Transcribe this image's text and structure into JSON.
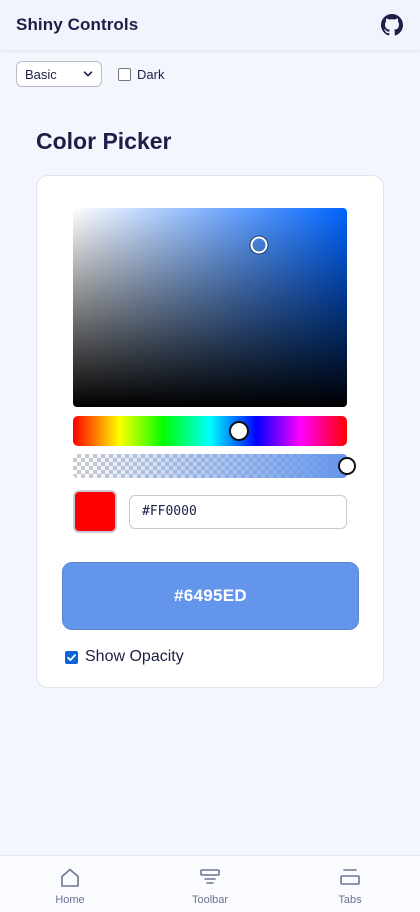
{
  "header": {
    "title": "Shiny Controls",
    "github_icon": "github-icon"
  },
  "controls": {
    "mode_select": {
      "value": "Basic",
      "icon": "chevron-down-icon"
    },
    "dark_toggle": {
      "label": "Dark",
      "checked": false
    }
  },
  "page": {
    "title": "Color Picker"
  },
  "color_picker": {
    "hue_color": "#0064FF",
    "saturation": 0.62,
    "value_level": 0.93,
    "hue_position": 0.61,
    "alpha": 1.0,
    "swatch_color": "#FF0000",
    "hex_input_value": "#FF0000",
    "result_label": "#6495ED",
    "result_color": "#6495ED",
    "show_opacity": {
      "label": "Show Opacity",
      "checked": true
    }
  },
  "bottom_nav": {
    "items": [
      {
        "label": "Home",
        "icon": "home-icon"
      },
      {
        "label": "Toolbar",
        "icon": "toolbar-icon"
      },
      {
        "label": "Tabs",
        "icon": "tabs-icon"
      }
    ]
  },
  "colors": {
    "accent": "#6495ED",
    "text_primary": "#1C1F46",
    "background": "#F4F6FD",
    "checkbox_checked": "#0A66D8"
  }
}
